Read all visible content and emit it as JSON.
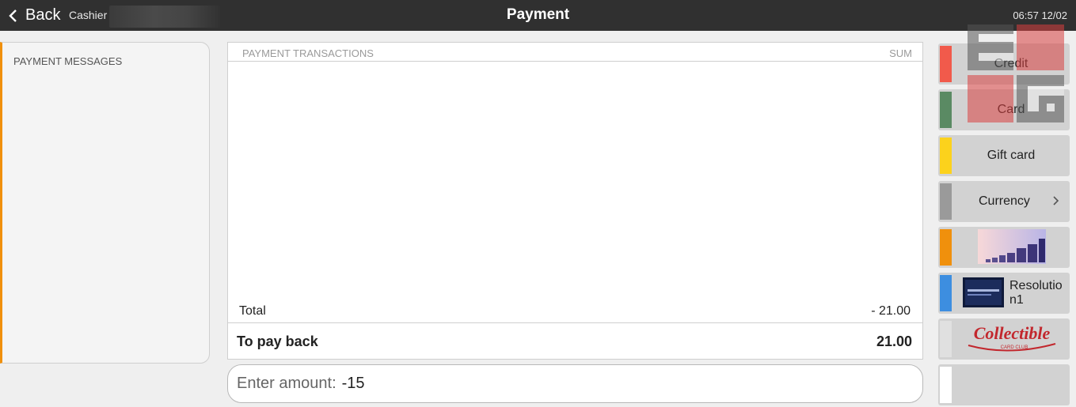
{
  "topbar": {
    "back_label": "Back",
    "cashier_label": "Cashier",
    "title": "Payment",
    "clock": "06:57 12/02"
  },
  "messages": {
    "title": "PAYMENT MESSAGES"
  },
  "transactions": {
    "col_left": "PAYMENT TRANSACTIONS",
    "col_right": "SUM",
    "rows": [],
    "total_label": "Total",
    "total_value": "- 21.00",
    "payback_label": "To pay back",
    "payback_value": "21.00"
  },
  "amount_input": {
    "placeholder": "Enter amount:",
    "value": "-15"
  },
  "payment_methods": [
    {
      "label": "Credit",
      "color": "#f15a4b"
    },
    {
      "label": "Card",
      "color": "#5a8a63"
    },
    {
      "label": "Gift card",
      "color": "#fcd21c"
    },
    {
      "label": "Currency",
      "color": "#9a9a9a",
      "icon": "chevron-right-icon"
    },
    {
      "label": "",
      "color": "#f0900c",
      "icon": "bar-chart-thumbnail"
    },
    {
      "label": "Resolution1",
      "color": "#3d8ee0",
      "icon": "screen-thumbnail"
    },
    {
      "label": "",
      "color": "#e0e0e0",
      "logo_text": "Collectible",
      "logo_sub": "CARD CLUB"
    },
    {
      "label": "",
      "color": "#ffffff"
    }
  ],
  "watermark": {
    "letters": [
      "E",
      "G"
    ]
  }
}
